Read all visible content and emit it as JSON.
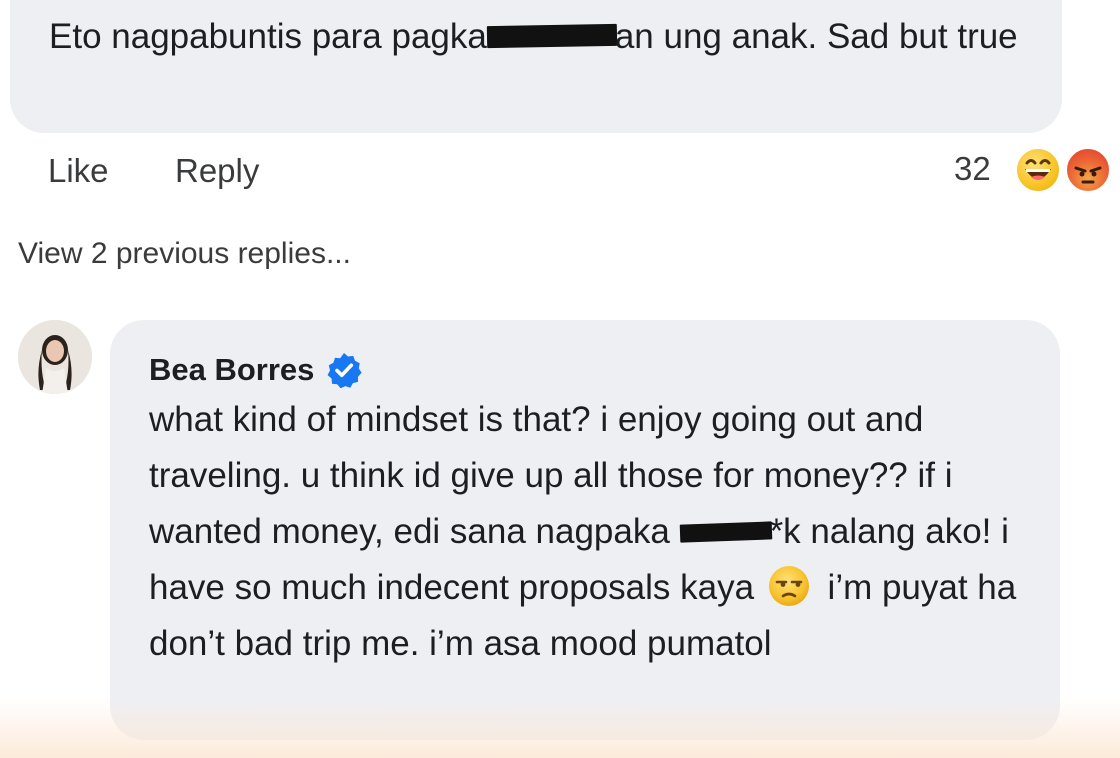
{
  "first_comment": {
    "text_before_redaction": "Eto nagpabuntis para pagka",
    "text_after_redaction": "an ung anak. Sad but true"
  },
  "actions": {
    "like_label": "Like",
    "reply_label": "Reply",
    "reaction_count": "32",
    "reactions": [
      "haha-reaction-icon",
      "angry-reaction-icon"
    ]
  },
  "view_previous": "View 2 previous replies...",
  "reply": {
    "author": "Bea Borres",
    "verified": true,
    "text_part1": "what kind of mindset is that? i enjoy going out and traveling. u think id give up all those for money?? if i wanted money, edi sana nagpaka ",
    "text_part2": "*k nalang ako! i have so much indecent proposals kaya ",
    "text_part3": " i’m puyat ha don’t bad trip me. i’m asa mood pumatol"
  },
  "colors": {
    "bubble_bg": "#eeeff3",
    "verified_blue": "#1877f2",
    "text": "#1c1e21"
  }
}
